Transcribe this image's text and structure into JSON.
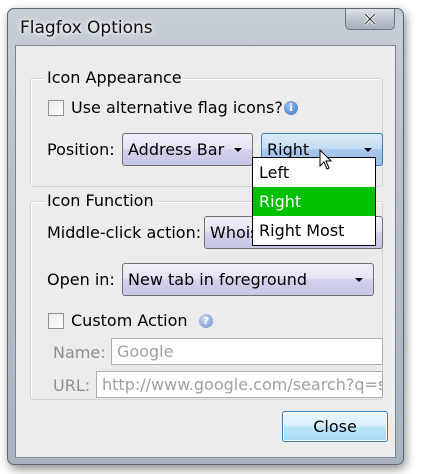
{
  "window": {
    "title": "Flagfox Options"
  },
  "icon_appearance": {
    "title": "Icon Appearance",
    "alt_flags_label": "Use alternative flag icons?",
    "alt_flags_checked": false,
    "position_label": "Position:",
    "position_value": "Address Bar",
    "side_value": "Right",
    "side_options": [
      "Left",
      "Right",
      "Right Most"
    ],
    "side_highlighted": "Right"
  },
  "icon_function": {
    "title": "Icon Function",
    "middle_click_label": "Middle-click action:",
    "middle_click_value": "Whois",
    "open_in_label": "Open in:",
    "open_in_value": "New tab in foreground",
    "custom_action_label": "Custom Action",
    "custom_action_checked": false,
    "name_label": "Name:",
    "name_value": "Google",
    "url_label": "URL:",
    "url_value": "http://www.google.com/search?q=sit"
  },
  "buttons": {
    "close_label": "Close"
  },
  "icons": {
    "info": "info-icon",
    "help": "help-icon",
    "window_close": "close-icon",
    "cursor": "mouse-cursor-icon"
  },
  "colors": {
    "highlight": "#00c000",
    "accent": "#3c7fb1"
  }
}
